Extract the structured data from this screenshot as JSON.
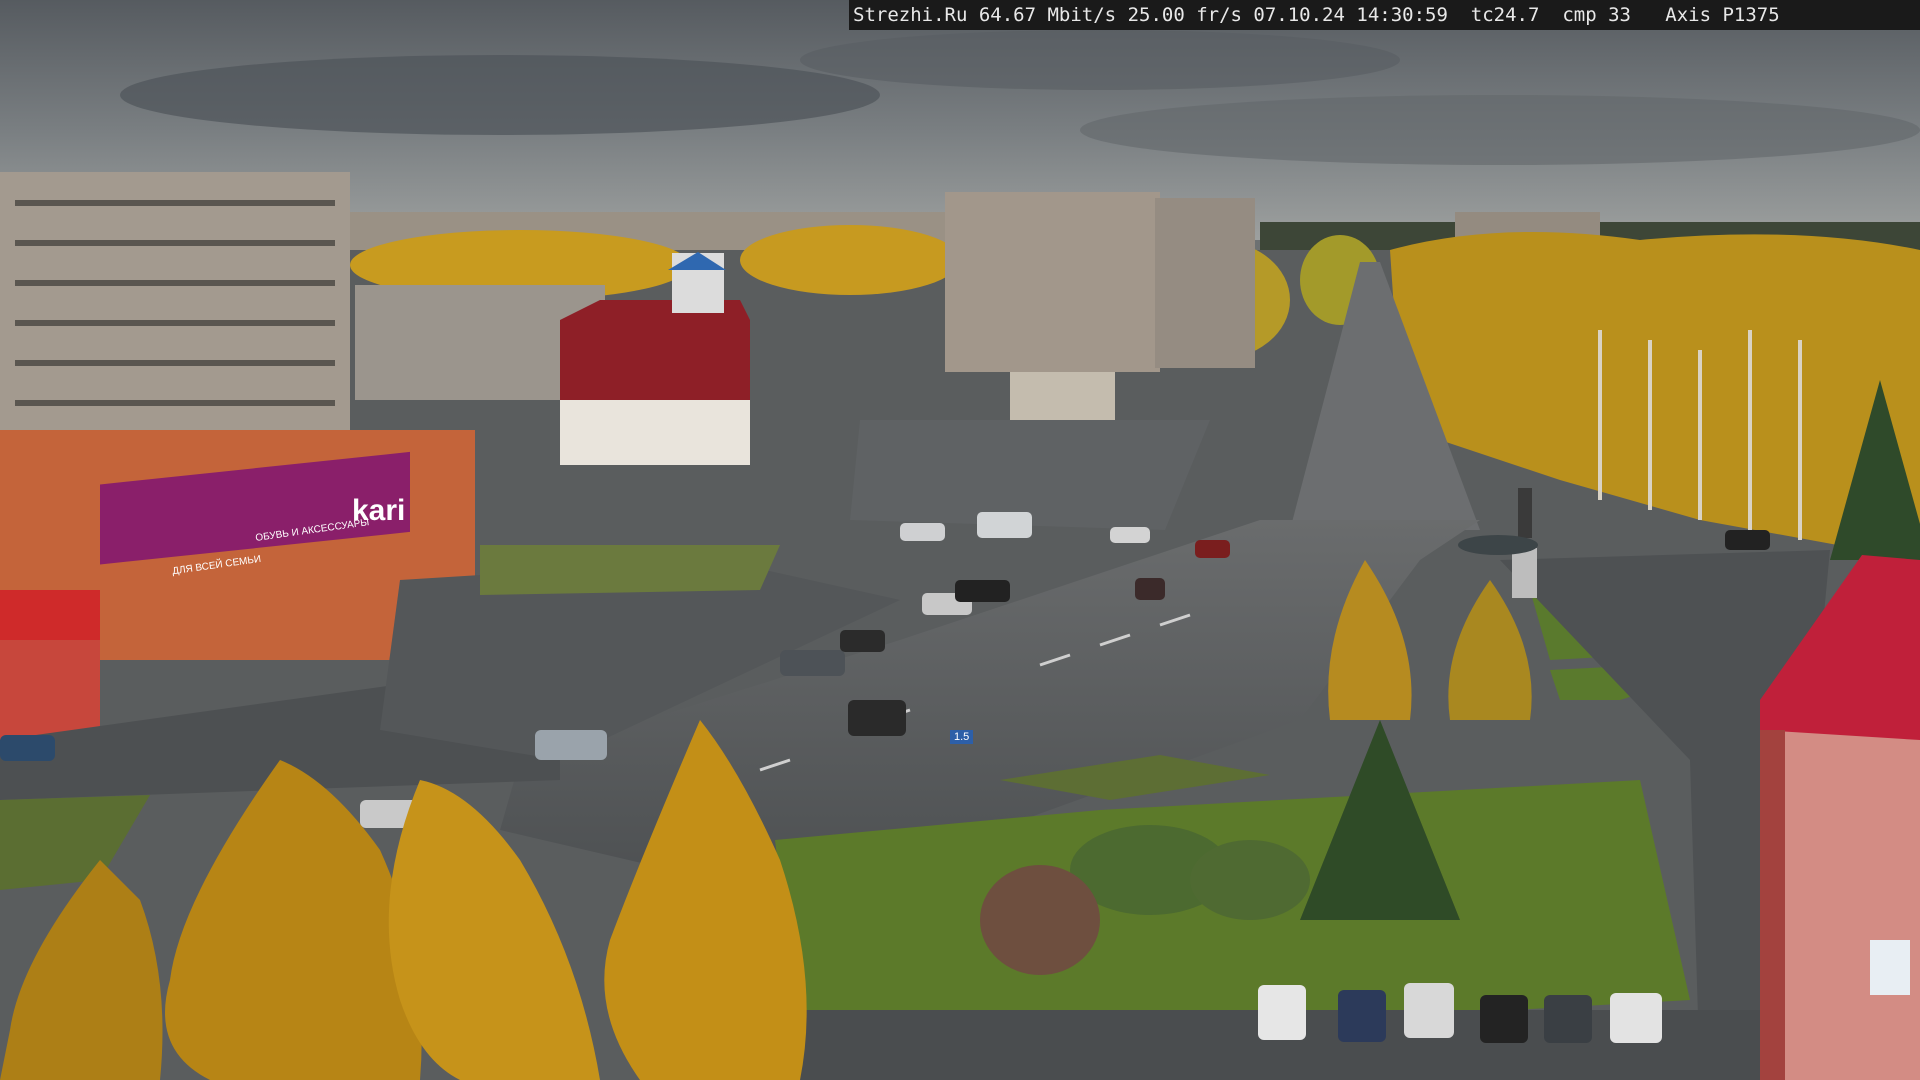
{
  "overlay": {
    "site": "Strezhi.Ru",
    "bitrate": "64.67 Mbit/s",
    "framerate": "25.00 fr/s",
    "date": "07.10.24",
    "time": "14:30:59",
    "tc": "tc24.7",
    "cmp": "cmp 33",
    "camera": "Axis P1375"
  },
  "signage": {
    "store_logo": "kari",
    "store_banner_line1": "ОБУВЬ И АКСЕССУАРЫ",
    "store_banner_line2": "ДЛЯ ВСЕЙ СЕМЬИ",
    "road_sign": "1.5"
  },
  "scene": {
    "description_colors": {
      "sky": "#6f7478",
      "cloud": "#8d9295",
      "asphalt": "#55585a",
      "grass": "#5f7a2f",
      "foliage_yellow": "#c99a1c",
      "foliage_green": "#3e5a2c",
      "building_panel": "#a59a8c",
      "kari_purple": "#8a1f6a",
      "brick_red": "#b23a32"
    }
  }
}
